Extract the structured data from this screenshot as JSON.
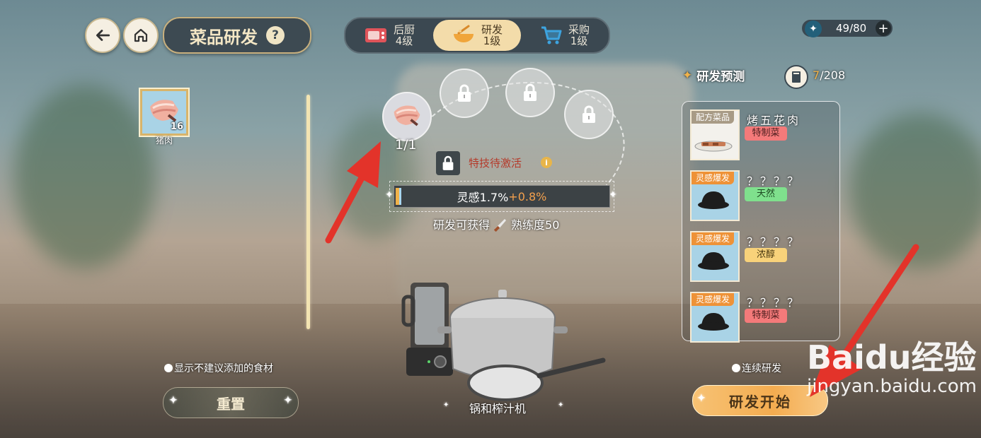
{
  "header": {
    "title": "菜品研发",
    "help_label": "?",
    "tabs": [
      {
        "label": "后厨",
        "level": "4级",
        "active": false
      },
      {
        "label": "研发",
        "level": "1级",
        "active": true
      },
      {
        "label": "采购",
        "level": "1级",
        "active": false
      }
    ],
    "energy": "49/80",
    "energy_plus": "+"
  },
  "ingredients": [
    {
      "name": "猪肉",
      "count": "16"
    }
  ],
  "slots": {
    "count_label": "1/1"
  },
  "skill": {
    "status": "特技待激活",
    "info_icon": "i"
  },
  "inspiration": {
    "base": "灵感1.7%",
    "bonus": "+0.8%",
    "fill_percent": 1.7
  },
  "gain": {
    "prefix": "研发可获得",
    "suffix": "熟练度50"
  },
  "utensil": {
    "name": "锅和榨汁机"
  },
  "options": {
    "show_not_recommended": "显示不建议添加的食材",
    "continuous": "连续研发"
  },
  "buttons": {
    "reset": "重置",
    "start": "研发开始"
  },
  "forecast": {
    "title": "研发预测",
    "count_current": "7",
    "count_total": "/208"
  },
  "recipes": [
    {
      "tag": "配方菜品",
      "name": "烤五花肉",
      "badge": "特制菜",
      "badge_color": "#f47a7a"
    },
    {
      "tag": "灵感爆发",
      "name": "？？？？",
      "badge": "天然",
      "badge_color": "#7fe08d"
    },
    {
      "tag": "灵感爆发",
      "name": "？？？？",
      "badge": "浓醇",
      "badge_color": "#f8d27a"
    },
    {
      "tag": "灵感爆发",
      "name": "？？？？",
      "badge": "特制菜",
      "badge_color": "#f47a7a"
    }
  ],
  "watermark": {
    "text": "Baidu经验",
    "url": "jingyan.baidu.com"
  },
  "colors": {
    "accent_orange": "#f4ac50",
    "panel_dark": "#3b4851",
    "highlight_red_arrow": "#e3332a"
  }
}
